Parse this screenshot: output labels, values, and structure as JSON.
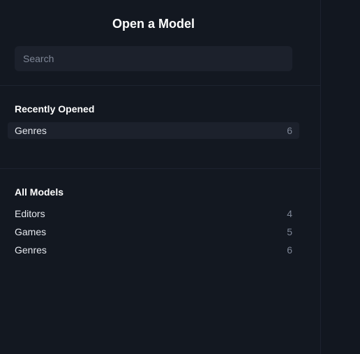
{
  "dialog": {
    "title": "Open a Model",
    "search_placeholder": "Search"
  },
  "recent": {
    "heading": "Recently Opened",
    "items": [
      {
        "name": "Genres",
        "count": "6"
      }
    ]
  },
  "all_models": {
    "heading": "All Models",
    "items": [
      {
        "name": "Editors",
        "count": "4"
      },
      {
        "name": "Games",
        "count": "5"
      },
      {
        "name": "Genres",
        "count": "6"
      }
    ]
  }
}
